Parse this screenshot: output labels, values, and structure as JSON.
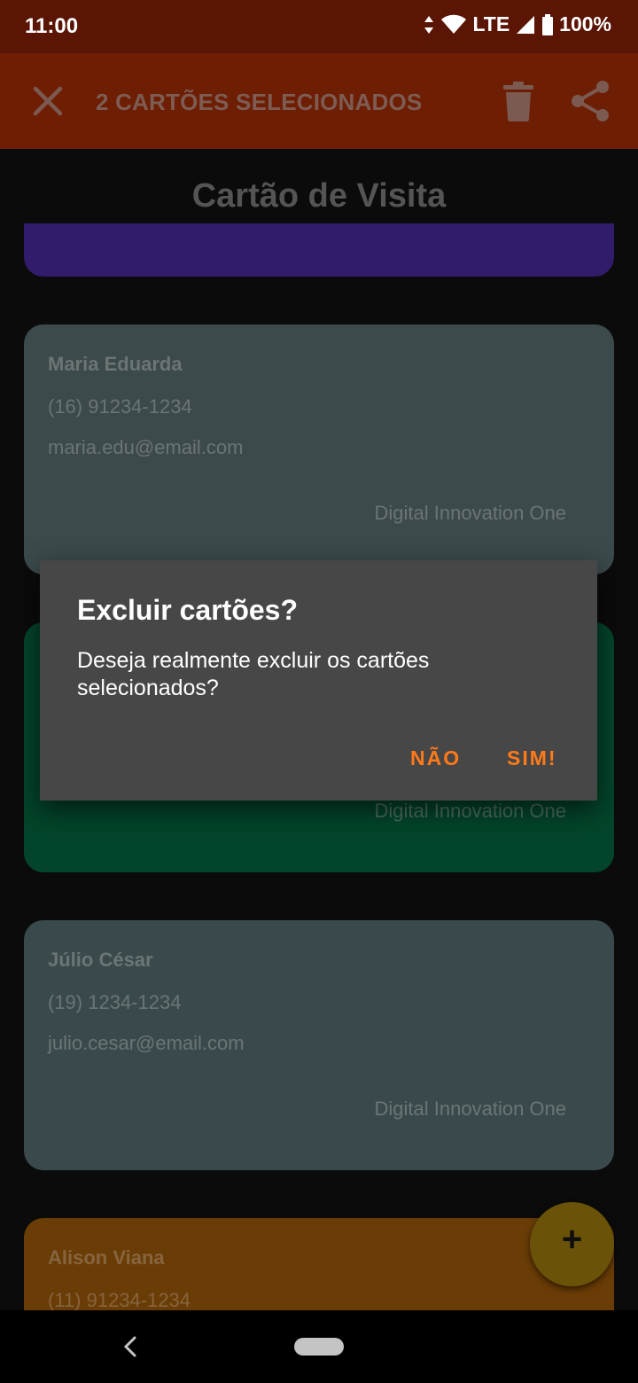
{
  "status_bar": {
    "time": "11:00",
    "network": "LTE",
    "battery": "100%"
  },
  "app_bar": {
    "title": "2 CARTÕES SELECIONADOS"
  },
  "page": {
    "title": "Cartão de Visita"
  },
  "cards": [
    {
      "name": "Maria Eduarda",
      "phone": "(16) 91234-1234",
      "email": "maria.edu@email.com",
      "company": "Digital Innovation One"
    },
    {
      "company": "Digital Innovation One"
    },
    {
      "name": "Júlio César",
      "phone": "(19) 1234-1234",
      "email": "julio.cesar@email.com",
      "company": "Digital Innovation One"
    },
    {
      "name": "Alison Viana",
      "phone": "(11) 91234-1234"
    }
  ],
  "fab": {
    "label": "+"
  },
  "dialog": {
    "title": "Excluir cartões?",
    "message": "Deseja realmente excluir os cartões selecionados?",
    "negative": "NÃO",
    "positive": "SIM!"
  },
  "colors": {
    "status_bar": "#5a1505",
    "app_bar": "#6e1e02",
    "accent": "#ff7a19",
    "dialog": "#474747"
  },
  "icons": [
    "close-icon",
    "delete-icon",
    "share-icon",
    "add-icon",
    "back-icon"
  ]
}
